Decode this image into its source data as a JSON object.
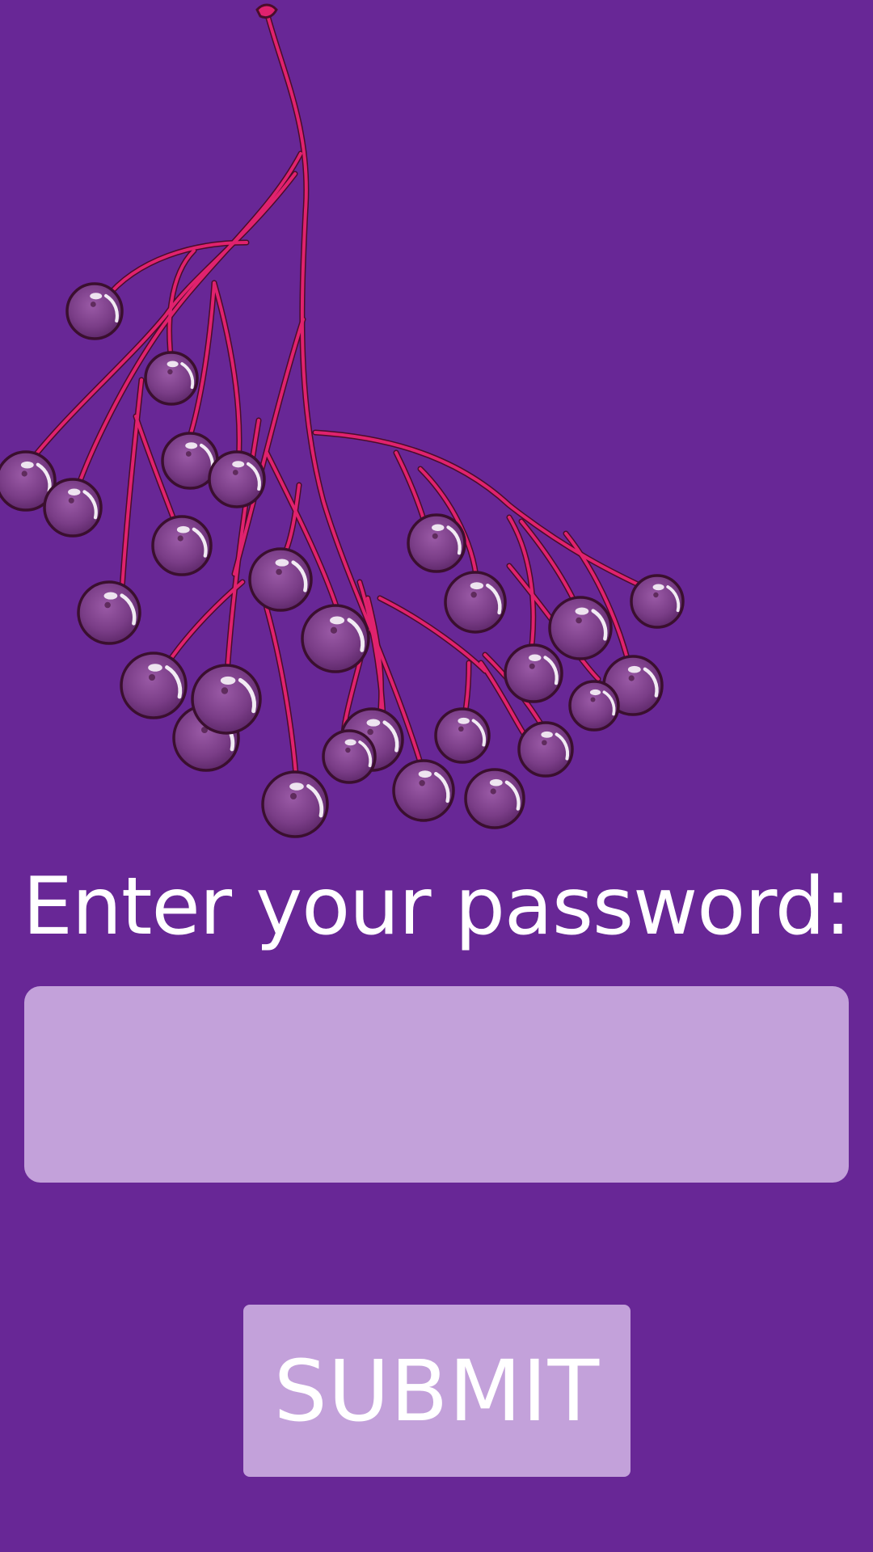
{
  "illustration": {
    "subject": "elderberry-cluster",
    "colors": {
      "background": "#682796",
      "stem": "#e0226e",
      "stem_outline": "#4a0d2a",
      "berry": "#7a3d87",
      "berry_dark": "#5a2566",
      "berry_outline": "#3a0f2e",
      "highlight": "#ffffff"
    }
  },
  "login": {
    "prompt": "Enter your password:",
    "password_value": "",
    "password_placeholder": "",
    "submit_label": "SUBMIT"
  },
  "colors": {
    "background": "#682796",
    "field": "#c3a1da",
    "text": "#ffffff"
  }
}
